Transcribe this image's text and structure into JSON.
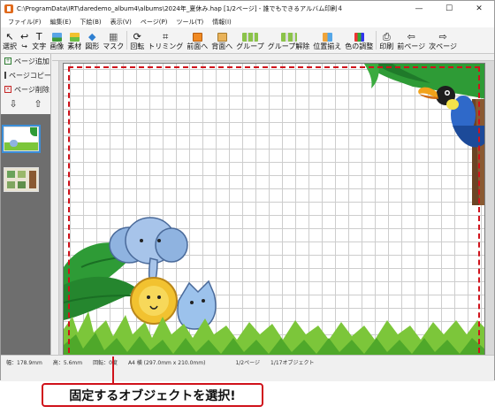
{
  "window": {
    "title": "C:\\ProgramData\\IRT\\daredemo_album4\\albums\\2024年_夏休み.hap [1/2ページ] - 誰でもできるアルバム印刷４",
    "controls": [
      "—",
      "☐",
      "✕"
    ]
  },
  "menu": [
    "ファイル(F)",
    "編集(E)",
    "下絵(B)",
    "表示(V)",
    "ページ(P)",
    "ツール(T)",
    "情報(I)"
  ],
  "toolbar": {
    "select": "選択",
    "text": "文字",
    "image": "画像",
    "material": "素材",
    "shape": "図形",
    "mask": "マスク",
    "rotate": "回転",
    "trim": "トリミング",
    "bring_front": "前面へ",
    "send_back": "背面へ",
    "group": "グループ",
    "ungroup": "グループ解除",
    "align": "位置揃え",
    "color_adjust": "色の調整",
    "print": "印刷",
    "prev_page": "前ページ",
    "next_page": "次ページ"
  },
  "sidebar": {
    "add_page": "ページ追加",
    "copy_page": "ページコピー",
    "delete_page": "ページ削除"
  },
  "status": {
    "width": "幅：178.9mm",
    "height": "高：5.6mm",
    "rotation": "回転：0度",
    "paper": "A4 横 (297.0mm x 210.0mm)",
    "page": "1/2ページ",
    "objects": "1/17オブジェクト"
  },
  "callout": {
    "text": "固定するオブジェクトを選択!"
  },
  "colors": {
    "accent_red": "#d0121b",
    "leaf_green": "#2e9b36",
    "grass_light": "#7cc63a"
  }
}
